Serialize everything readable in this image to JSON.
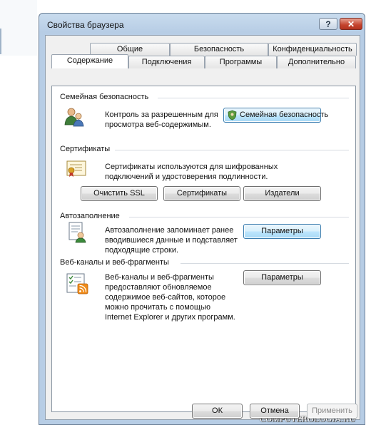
{
  "dialog": {
    "title": "Свойства браузера",
    "help_label": "?",
    "close_label": "✕"
  },
  "tabs": {
    "row_back": [
      "Общие",
      "Безопасность",
      "Конфиденциальность"
    ],
    "row_front": [
      "Содержание",
      "Подключения",
      "Программы",
      "Дополнительно"
    ],
    "active": "Содержание"
  },
  "family": {
    "title": "Семейная безопасность",
    "desc_line1": "Контроль за разрешенным для",
    "desc_line2": "просмотра веб-содержимым.",
    "button": "Семейная безопасность"
  },
  "certificates": {
    "title": "Сертификаты",
    "desc_line1": "Сертификаты используются для шифрованных",
    "desc_line2": "подключений и удостоверения подлинности.",
    "clear_ssl": "Очистить SSL",
    "certs": "Сертификаты",
    "publishers": "Издатели"
  },
  "autocomplete": {
    "title": "Автозаполнение",
    "desc_line1": "Автозаполнение запоминает ранее",
    "desc_line2": "вводившиеся данные и подставляет",
    "desc_line3": "подходящие строки.",
    "button": "Параметры"
  },
  "feeds": {
    "title": "Веб-каналы и веб-фрагменты",
    "desc_line1": "Веб-каналы и веб-фрагменты",
    "desc_line2": "предоставляют обновляемое",
    "desc_line3": "содержимое веб-сайтов, которое",
    "desc_line4": "можно прочитать с помощью",
    "desc_line5": "Internet Explorer и других программ.",
    "button": "Параметры"
  },
  "footer": {
    "ok": "ОК",
    "cancel": "Отмена",
    "apply": "Применить"
  },
  "watermark": "COMPUTEROLOGIA.RU",
  "icons": [
    "family-safety-icon",
    "certificate-icon",
    "autocomplete-icon",
    "feeds-icon",
    "shield-icon"
  ]
}
